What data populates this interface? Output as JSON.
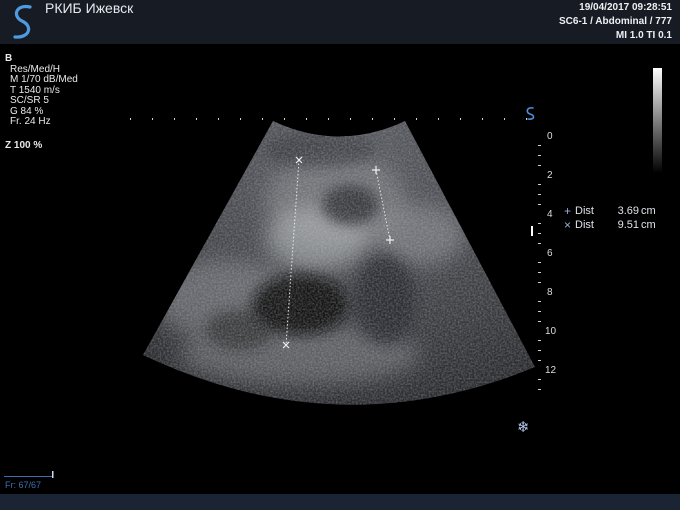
{
  "header": {
    "clinic_name": "РКИБ Ижевск",
    "datetime": "19/04/2017 09:28:51",
    "probe_preset": "SC6-1 / Abdominal / 777",
    "indices": "MI 1.0  TI 0.1"
  },
  "params": {
    "mode": "B",
    "res": "Res/Med/H",
    "map": "M 1/70 dB/Med",
    "sound_speed": "T 1540 m/s",
    "scsr": "SC/SR 5",
    "gain": "G 84 %",
    "frame_rate": "Fr. 24 Hz",
    "zoom": "Z  100  %"
  },
  "depth_scale": {
    "labels": [
      "0",
      "2",
      "4",
      "6",
      "8",
      "10",
      "12"
    ]
  },
  "measurements": [
    {
      "symbol": "+",
      "label": "Dist",
      "value": "3.69",
      "unit": "cm"
    },
    {
      "symbol": "×",
      "label": "Dist",
      "value": "9.51",
      "unit": "cm"
    }
  ],
  "cine": {
    "frame_label": "Fr: 67/67"
  },
  "icons": {
    "logo": "probe-s-logo-icon",
    "orientation": "orientation-marker-icon",
    "freeze": "snowflake-freeze-icon"
  },
  "colors": {
    "header_bg": "#161b24",
    "accent_blue": "#4f8fd6",
    "cine_blue": "#3f6fae"
  }
}
